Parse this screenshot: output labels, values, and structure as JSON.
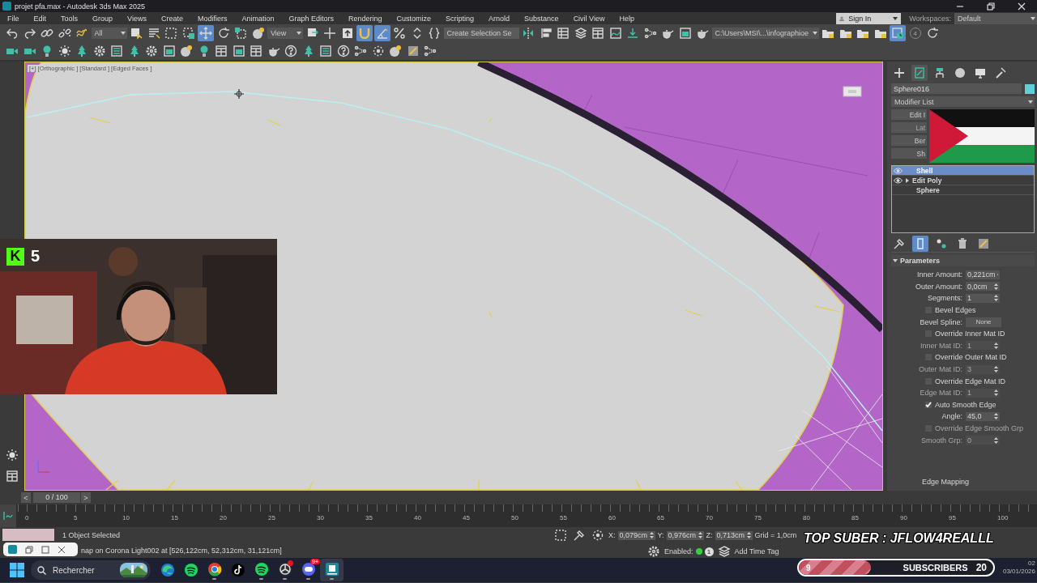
{
  "window": {
    "title": "projet pfa.max - Autodesk 3ds Max 2025"
  },
  "menu": [
    "File",
    "Edit",
    "Tools",
    "Group",
    "Views",
    "Create",
    "Modifiers",
    "Animation",
    "Graph Editors",
    "Rendering",
    "Customize",
    "Scripting",
    "Arnold",
    "Substance",
    "Civil View",
    "Help"
  ],
  "account": {
    "sign_in": "Sign In",
    "workspaces_label": "Workspaces:",
    "workspace": "Default"
  },
  "toolbar_main": [
    {
      "kind": "undo",
      "on": false
    },
    {
      "kind": "redo",
      "on": false
    },
    {
      "kind": "link",
      "on": false
    },
    {
      "kind": "broken-link",
      "on": false
    },
    {
      "kind": "wave",
      "on": false
    },
    {
      "kind": "dropdown",
      "text": "All"
    },
    {
      "kind": "cursor-square",
      "on": false
    },
    {
      "kind": "cursor-list",
      "on": false
    },
    {
      "kind": "dashed-square",
      "on": false
    },
    {
      "kind": "crossing-square",
      "on": false
    },
    {
      "kind": "move",
      "on": true
    },
    {
      "kind": "rotate",
      "on": false
    },
    {
      "kind": "scale-square",
      "on": false
    },
    {
      "kind": "sphere",
      "on": false
    },
    {
      "kind": "dropdown",
      "text": "View"
    },
    {
      "kind": "pivot",
      "on": false
    },
    {
      "kind": "cross",
      "on": false
    },
    {
      "kind": "upload",
      "on": false
    },
    {
      "kind": "magnet",
      "on": true
    },
    {
      "kind": "angle",
      "on": true
    },
    {
      "kind": "percent",
      "on": false
    },
    {
      "kind": "spinner-arrows",
      "on": false
    },
    {
      "kind": "braces",
      "on": false
    },
    {
      "kind": "field",
      "text": "Create Selection Se"
    },
    {
      "kind": "mirror",
      "on": false
    },
    {
      "kind": "align",
      "on": false
    },
    {
      "kind": "table",
      "on": false
    },
    {
      "kind": "layers",
      "on": false
    },
    {
      "kind": "grid-window",
      "on": false
    },
    {
      "kind": "curve-window",
      "on": false
    },
    {
      "kind": "download",
      "on": false
    },
    {
      "kind": "nodes",
      "on": false
    },
    {
      "kind": "teapot",
      "on": false
    },
    {
      "kind": "image-window",
      "on": false
    },
    {
      "kind": "teapot",
      "on": false
    },
    {
      "kind": "dropdown",
      "text": "C:\\Users\\MSI\\...\\infographioe"
    },
    {
      "kind": "folder",
      "on": false
    },
    {
      "kind": "folder",
      "on": false
    },
    {
      "kind": "folder",
      "on": false
    },
    {
      "kind": "folder",
      "on": false
    },
    {
      "kind": "clock",
      "on": true
    },
    {
      "kind": "counter",
      "text": "4"
    },
    {
      "kind": "rotate",
      "on": false
    }
  ],
  "toolbar_secondary": [
    {
      "kind": "camera",
      "on": false
    },
    {
      "kind": "camera",
      "on": false
    },
    {
      "kind": "bulb",
      "on": false
    },
    {
      "kind": "sun",
      "on": false
    },
    {
      "kind": "tree",
      "on": false
    },
    {
      "kind": "gear",
      "on": false
    },
    {
      "kind": "list",
      "on": false
    },
    {
      "kind": "tree",
      "on": false
    },
    {
      "kind": "gear",
      "on": false
    },
    {
      "kind": "image-window",
      "on": false
    },
    {
      "kind": "sphere",
      "on": false
    },
    {
      "kind": "bulb",
      "on": false
    },
    {
      "kind": "grid-window",
      "on": false
    },
    {
      "kind": "image-window",
      "on": false
    },
    {
      "kind": "grid-window",
      "on": false
    },
    {
      "kind": "teapot",
      "on": false
    },
    {
      "kind": "help",
      "on": false
    },
    {
      "kind": "tree",
      "on": false
    },
    {
      "kind": "list",
      "on": false
    },
    {
      "kind": "help",
      "on": false
    },
    {
      "kind": "nodes",
      "on": false
    },
    {
      "kind": "target",
      "on": false
    },
    {
      "kind": "sphere",
      "on": false
    },
    {
      "kind": "config",
      "on": false
    },
    {
      "kind": "nodes",
      "on": false
    }
  ],
  "viewport": {
    "label": "[+] [Orthographic ] [Standard ] [Edged Faces ]"
  },
  "webcam": {
    "kind": "picture",
    "badge_logo": "K",
    "badge_count": "5"
  },
  "command_panel": {
    "tabs": [
      {
        "kind": "plus",
        "selected": false
      },
      {
        "kind": "modify",
        "selected": true
      },
      {
        "kind": "hierarchy",
        "selected": false
      },
      {
        "kind": "motion-circle",
        "selected": false
      },
      {
        "kind": "monitor",
        "selected": false
      },
      {
        "kind": "wrench",
        "selected": false
      }
    ],
    "object_name": "Sphere016",
    "modifier_list": "Modifier List",
    "modifier_buttons": [
      {
        "text": "Edit I",
        "disabled": false
      },
      {
        "text": "Lat",
        "disabled": true
      },
      {
        "text": "Ber",
        "disabled": false
      },
      {
        "text": "Sh",
        "disabled": false
      }
    ],
    "stack": [
      {
        "label": "Shell",
        "selected": true,
        "visible": true,
        "expandable": false
      },
      {
        "label": "Edit Poly",
        "selected": false,
        "visible": true,
        "expandable": true
      },
      {
        "label": "Sphere",
        "selected": false,
        "visible": false,
        "expandable": false
      }
    ],
    "stack_tools": [
      {
        "kind": "pin",
        "on": false
      },
      {
        "kind": "end-result",
        "on": true
      },
      {
        "kind": "unique-dots",
        "on": false
      },
      {
        "kind": "trash",
        "on": false
      },
      {
        "kind": "config",
        "on": false
      }
    ],
    "rollout": "Parameters",
    "params": [
      {
        "kind": "spinner",
        "label": "Inner Amount:",
        "value": "0,221cm",
        "disabled": false
      },
      {
        "kind": "spinner",
        "label": "Outer Amount:",
        "value": "0,0cm",
        "disabled": false
      },
      {
        "kind": "spinner",
        "label": "Segments:",
        "value": "1",
        "disabled": false
      },
      {
        "kind": "checkbox",
        "label": "Bevel Edges",
        "checked": false,
        "disabled": false
      },
      {
        "kind": "button",
        "label": "Bevel Spline:",
        "value": "None",
        "disabled": false
      },
      {
        "kind": "checkbox",
        "label": "Override Inner Mat ID",
        "checked": false,
        "disabled": false
      },
      {
        "kind": "spinner",
        "label": "Inner Mat ID:",
        "value": "1",
        "disabled": true
      },
      {
        "kind": "checkbox",
        "label": "Override Outer Mat ID",
        "checked": false,
        "disabled": false
      },
      {
        "kind": "spinner",
        "label": "Outer Mat ID:",
        "value": "3",
        "disabled": true
      },
      {
        "kind": "checkbox",
        "label": "Override Edge Mat ID",
        "checked": false,
        "disabled": false
      },
      {
        "kind": "spinner",
        "label": "Edge Mat ID:",
        "value": "1",
        "disabled": true
      },
      {
        "kind": "checkbox",
        "label": "Auto Smooth Edge",
        "checked": true,
        "disabled": false
      },
      {
        "kind": "spinner",
        "label": "Angle:",
        "value": "45,0",
        "disabled": false
      },
      {
        "kind": "checkbox",
        "label": "Override Edge Smooth Grp",
        "checked": false,
        "disabled": true
      },
      {
        "kind": "spinner",
        "label": "Smooth Grp:",
        "value": "0",
        "disabled": true
      },
      {
        "kind": "heading",
        "label": "Edge Mapping"
      }
    ]
  },
  "timeline": {
    "prev": "<",
    "frame": "0 / 100",
    "next": ">",
    "level": 0,
    "ticks": [
      "0",
      "5",
      "10",
      "15",
      "20",
      "25",
      "30",
      "35",
      "40",
      "45",
      "50",
      "55",
      "60",
      "65",
      "70",
      "75",
      "80",
      "85",
      "90",
      "95",
      "100"
    ]
  },
  "status": {
    "selection": "1 Object Selected",
    "prompt": "nap on Corona Light002 at [526,122cm, 52,312cm, 31,121cm]",
    "coords": [
      {
        "label": "X:",
        "value": "0,079cm"
      },
      {
        "label": "Y:",
        "value": "0,976cm"
      },
      {
        "label": "Z:",
        "value": "0,713cm"
      }
    ],
    "grid": "Grid = 1,0cm",
    "enabled_label": "Enabled:",
    "enabled": true,
    "counter": "1",
    "time_tag": "Add Time Tag"
  },
  "overlay": {
    "top_suber": "TOP SUBER : JFLOW4REALLL",
    "current": "9",
    "label": "SUBSCRIBERS",
    "goal": "20",
    "level": 0.37
  },
  "taskbar": {
    "search": "Rechercher",
    "apps": [
      {
        "kind": "swirl-circle",
        "running": false,
        "selected": false,
        "alert": false
      },
      {
        "kind": "sound-circle",
        "running": false,
        "selected": false,
        "alert": false
      },
      {
        "kind": "ring-circle",
        "running": true,
        "selected": false,
        "alert": false
      },
      {
        "kind": "note-circle",
        "running": false,
        "selected": false,
        "alert": false
      },
      {
        "kind": "sound-circle",
        "running": true,
        "selected": false,
        "alert": false
      },
      {
        "kind": "aperture-circle",
        "running": true,
        "selected": false,
        "alert": true
      },
      {
        "kind": "gamepad-circle",
        "running": true,
        "selected": false,
        "alert": false,
        "badge": "9+"
      },
      {
        "kind": "cube-app",
        "running": true,
        "selected": true,
        "alert": false
      }
    ],
    "clock": {
      "time": "02",
      "date": "03/01/2026"
    }
  }
}
